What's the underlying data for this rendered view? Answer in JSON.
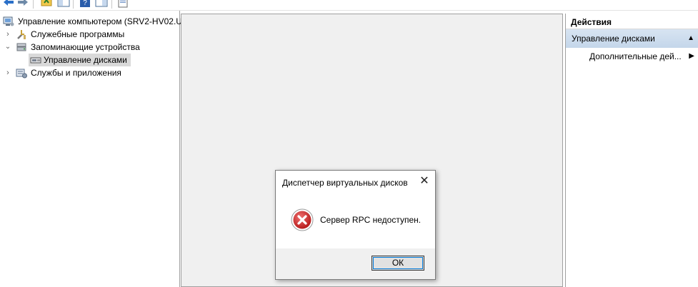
{
  "toolbar": {
    "buttons": [
      "back-arrow",
      "forward-arrow",
      "up-folder",
      "show-hide-tree",
      "help",
      "show-hide-action-pane",
      "properties"
    ]
  },
  "tree": {
    "root": "Управление компьютером (SRV2-HV02.U",
    "items": [
      {
        "label": "Служебные программы",
        "expanded": false
      },
      {
        "label": "Запоминающие устройства",
        "expanded": true
      },
      {
        "label": "Управление дисками",
        "selected": true
      },
      {
        "label": "Службы и приложения",
        "expanded": false
      }
    ]
  },
  "actions": {
    "header": "Действия",
    "section": "Управление дисками",
    "items": [
      "Дополнительные дей..."
    ]
  },
  "dialog": {
    "title": "Диспетчер виртуальных дисков",
    "close_glyph": "✕",
    "message": "Сервер RPC недоступен.",
    "ok_label": "ОК"
  },
  "colors": {
    "selection_gray": "#d9d9d9",
    "actions_section_blue": "#c9d9ec",
    "error_red": "#d32f2f",
    "focus_blue": "#0078d7"
  }
}
